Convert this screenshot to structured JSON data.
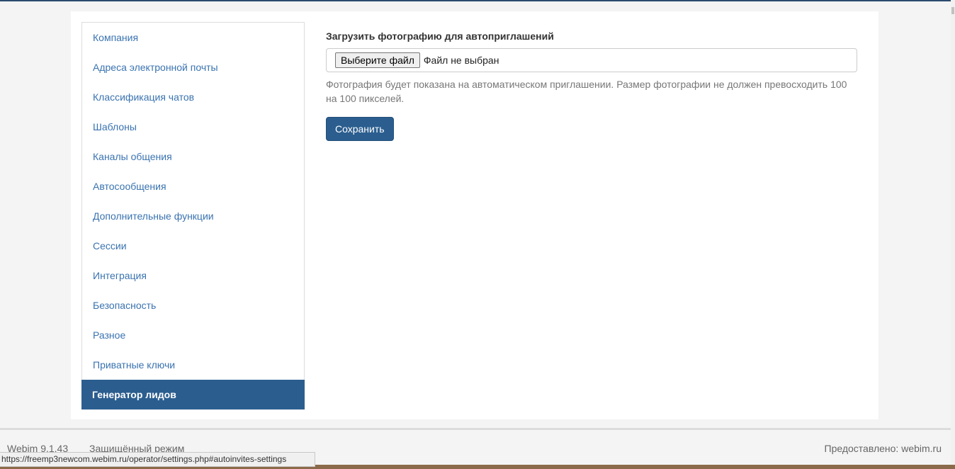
{
  "sidebar": {
    "items": [
      {
        "label": "Компания"
      },
      {
        "label": "Адреса электронной почты"
      },
      {
        "label": "Классификация чатов"
      },
      {
        "label": "Шаблоны"
      },
      {
        "label": "Каналы общения"
      },
      {
        "label": "Автосообщения"
      },
      {
        "label": "Дополнительные функции"
      },
      {
        "label": "Сессии"
      },
      {
        "label": "Интеграция"
      },
      {
        "label": "Безопасность"
      },
      {
        "label": "Разное"
      },
      {
        "label": "Приватные ключи"
      },
      {
        "label": "Генератор лидов"
      }
    ],
    "active_index": 12
  },
  "main": {
    "upload_label": "Загрузить фотографию для автоприглашений",
    "file_button_label": "Выберите файл",
    "file_status": "Файл не выбран",
    "help_text": "Фотография будет показана на автоматическом приглашении. Размер фотографии не должен превосходить 100 на 100 пикселей.",
    "save_label": "Сохранить"
  },
  "footer": {
    "version": "Webim 9.1.43",
    "mode": "Защищённый режим",
    "powered_by": "Предоставлено: webim.ru"
  },
  "status_bar": {
    "url": "https://freemp3newcom.webim.ru/operator/settings.php#autoinvites-settings"
  },
  "colors": {
    "accent": "#2b5e8f",
    "link": "#3a73b0"
  }
}
